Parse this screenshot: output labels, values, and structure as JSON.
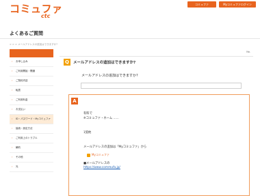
{
  "_uncertain_readings": [
    "logo-sub tagline is an unreadable few-character string and is left empty",
    "first header button label is partly unreadable; only 'コミュファ' survives",
    "breadcrumb below the title is unreadable; only a four-segment outline is kept",
    "question number is shown as 'No.' plus an unreadable number (number left empty)",
    "category line above the answer is unreadable; only its three-segment outline is kept",
    "answer body lines are reconstructed from partly legible text (see notes on each line)",
    "URL in the answer is legible except for its tail; the rest is left out"
  ],
  "header": {
    "logo_text": "コミュファ",
    "logo_sub": "",
    "logo_brand": "ctc",
    "buttons": [
      "コミュファ",
      "Myコミュファログイン"
    ]
  },
  "page_title": "よくあるご質問",
  "breadcrumb": {
    "items": [
      "",
      "",
      "",
      "メールアドレスの追加はできますか?"
    ]
  },
  "sidebar": {
    "heading": "",
    "items": [
      {
        "label": "お申し込み"
      },
      {
        "label": "ご利用開始・開通"
      },
      {
        "label": "ご契約内容"
      },
      {
        "label": "転居"
      },
      {
        "label": "ご利用料金"
      },
      {
        "label": "お支払い"
      },
      {
        "label": "ID・パスワード・Myコミュファ"
      },
      {
        "label": "接続・設定方法"
      },
      {
        "label": "ご利用上のトラブル"
      },
      {
        "label": "解約"
      },
      {
        "label": "その他"
      },
      {
        "label": "光"
      }
    ],
    "selected_index": 6
  },
  "question": {
    "back_label": "",
    "number_label": "No.",
    "number": "",
    "badge": "Q",
    "title": "メールアドレスの追加はできますか?",
    "text": "メールアドレスの追加はできますか?",
    "category_line": ""
  },
  "answer": {
    "badge": "A",
    "lines": [
      "有料で",
      "※コミュファ・ホーム ......",
      "",
      "1契約",
      "",
      "メールアドレスの追加は「Myコミュファ」から"
    ],
    "mycommufa_label": "Myコミュファ",
    "link_prefix": "■メールアドレスの",
    "link_url": "https://www.commufa.jp/"
  },
  "colors": {
    "accent": "#e8641e",
    "q_badge": "#f3a000",
    "link": "#1a5fb4"
  }
}
